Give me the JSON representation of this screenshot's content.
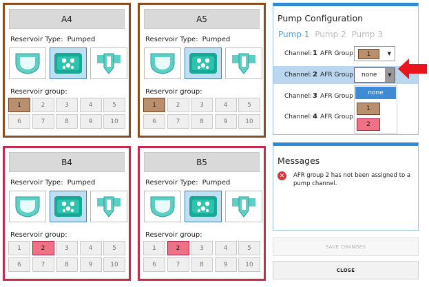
{
  "cards": [
    {
      "title": "A4",
      "reservoir_type_label": "Reservoir Type:",
      "reservoir_type": "Pumped",
      "reservoir_group_label": "Reservoir group:",
      "selected_group": 1,
      "group_color": "brown"
    },
    {
      "title": "A5",
      "reservoir_type_label": "Reservoir Type:",
      "reservoir_type": "Pumped",
      "reservoir_group_label": "Reservoir group:",
      "selected_group": 1,
      "group_color": "brown"
    },
    {
      "title": "B4",
      "reservoir_type_label": "Reservoir Type:",
      "reservoir_type": "Pumped",
      "reservoir_group_label": "Reservoir group:",
      "selected_group": 2,
      "group_color": "pink"
    },
    {
      "title": "B5",
      "reservoir_type_label": "Reservoir Type:",
      "reservoir_type": "Pumped",
      "reservoir_group_label": "Reservoir group:",
      "selected_group": 2,
      "group_color": "pink"
    }
  ],
  "groups": [
    "1",
    "2",
    "3",
    "4",
    "5",
    "6",
    "7",
    "8",
    "9",
    "10"
  ],
  "reservoir_icons": [
    "open-reservoir-icon",
    "pumped-reservoir-icon",
    "tube-reservoir-icon"
  ],
  "pump_config": {
    "title": "Pump Configuration",
    "tabs": [
      "Pump 1",
      "Pump 2",
      "Pump 3"
    ],
    "active_tab": 0,
    "channels": [
      {
        "label": "Channel:",
        "num": "1",
        "afr_label": "AFR Group:",
        "value": "1"
      },
      {
        "label": "Channel:",
        "num": "2",
        "afr_label": "AFR Group:",
        "value": "none"
      },
      {
        "label": "Channel:",
        "num": "3",
        "afr_label": "AFR Group:",
        "value": ""
      },
      {
        "label": "Channel:",
        "num": "4",
        "afr_label": "AFR Group:",
        "value": ""
      }
    ],
    "dropdown_options": [
      "none",
      "1",
      "2"
    ]
  },
  "messages": {
    "title": "Messages",
    "items": [
      {
        "icon": "error-icon",
        "glyph": "✕",
        "text": "AFR group 2 has not been assigned to a pump channel."
      }
    ]
  },
  "buttons": {
    "save": "SAVE CHANGES",
    "close": "CLOSE"
  },
  "colors": {
    "brown_border": "#8b4d1e",
    "red_border": "#c42b4a",
    "group1": "#b98f6e",
    "group2": "#ee7185",
    "accent": "#2e8ad6",
    "arrow": "#e8161c"
  }
}
